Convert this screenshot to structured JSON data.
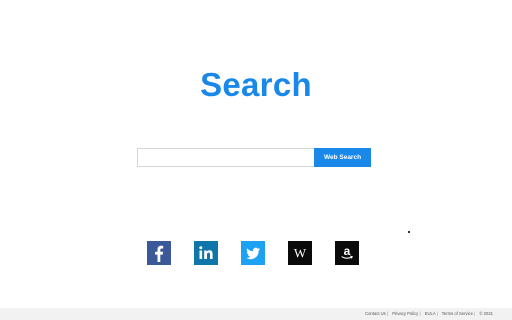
{
  "logo": {
    "text": "Search"
  },
  "search": {
    "placeholder": "",
    "value": "",
    "button_label": "Web Search"
  },
  "social": [
    {
      "name": "facebook",
      "glyph": "f",
      "color": "#3b5998"
    },
    {
      "name": "linkedin",
      "glyph": "in",
      "color": "#0e76a8"
    },
    {
      "name": "twitter",
      "glyph": "bird",
      "color": "#1da1f2"
    },
    {
      "name": "wikipedia",
      "glyph": "W",
      "color": "#0a0a0a"
    },
    {
      "name": "amazon",
      "glyph": "a",
      "color": "#0a0a0a"
    }
  ],
  "footer": {
    "links": [
      "Contact Us",
      "Privacy Policy",
      "EULA",
      "Terms of Service"
    ],
    "copyright": "© 2021"
  },
  "colors": {
    "accent": "#1a88e8",
    "footer_bg": "#f2f2f2"
  }
}
